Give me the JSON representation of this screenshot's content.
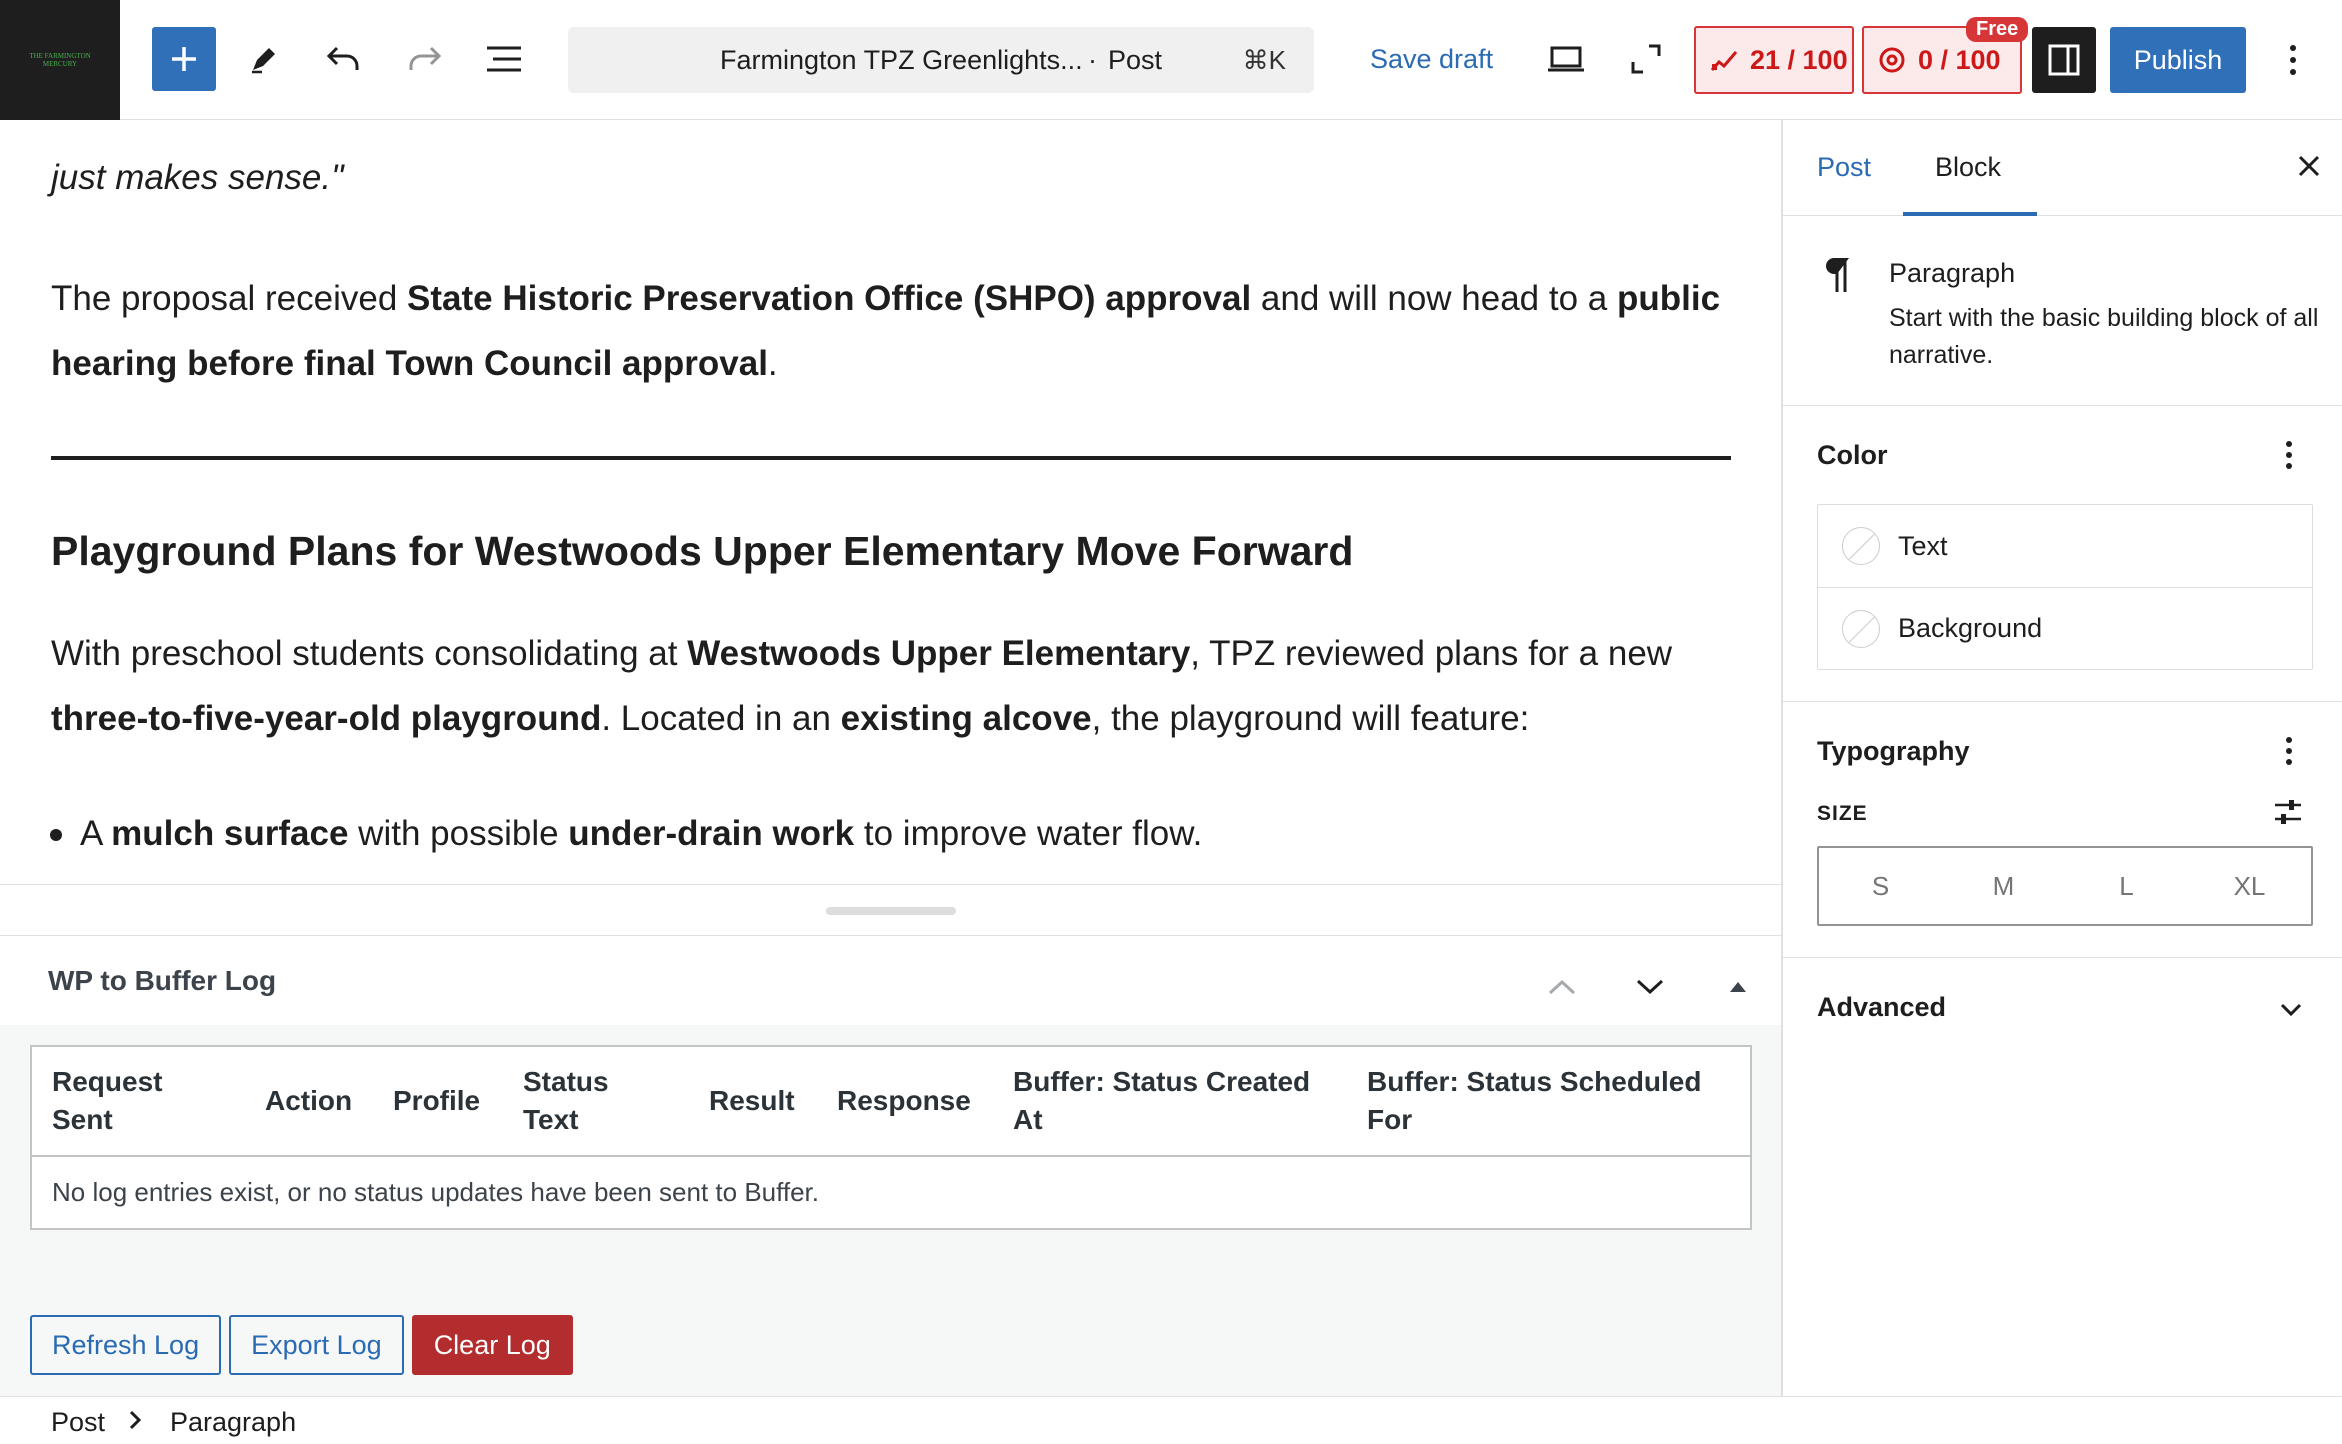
{
  "topbar": {
    "logo_text": "THE FARMINGTON MERCURY",
    "document_title": "Farmington TPZ Greenlights...",
    "document_separator": "·",
    "document_type": "Post",
    "shortcut": "⌘K",
    "save_draft_label": "Save draft",
    "seo_score": "21 / 100",
    "readability_score": "0 / 100",
    "free_tag": "Free",
    "publish_label": "Publish",
    "colors": {
      "accent": "#3070b8",
      "danger": "#d63638",
      "dark": "#1e1e1e"
    }
  },
  "editor": {
    "para1_quote_end": "just makes sense.\"",
    "para2": {
      "t1": "The proposal received ",
      "b1": "State Historic Preservation Office (SHPO) approval",
      "t2": " and will now head to a ",
      "b2": "public hearing before final Town Council approval",
      "t3": "."
    },
    "heading": "Playground Plans for Westwoods Upper Elementary Move Forward",
    "para3": {
      "t1": "With preschool students consolidating at ",
      "b1": "Westwoods Upper Elementary",
      "t2": ", TPZ reviewed plans for a new ",
      "b2": "three-to-five-year-old playground",
      "t3": ". Located in an ",
      "b3": "existing alcove",
      "t4": ", the playground will feature:"
    },
    "list_item1": {
      "t1": "A ",
      "b1": "mulch surface",
      "t2": " with possible ",
      "b2": "under-drain work",
      "t3": " to improve water flow."
    }
  },
  "meta_box": {
    "title": "WP to Buffer Log",
    "columns": [
      "Request Sent",
      "Action",
      "Profile",
      "Status Text",
      "Result",
      "Response",
      "Buffer: Status Created At",
      "Buffer: Status Scheduled For"
    ],
    "empty_message": "No log entries exist, or no status updates have been sent to Buffer.",
    "buttons": {
      "refresh": "Refresh Log",
      "export": "Export Log",
      "clear": "Clear Log"
    }
  },
  "footer": {
    "breadcrumbs": [
      "Post",
      "Paragraph"
    ]
  },
  "sidebar": {
    "tabs": [
      "Post",
      "Block"
    ],
    "active_tab": "Block",
    "block": {
      "name": "Paragraph",
      "description": "Start with the basic building block of all narrative."
    },
    "color_panel": {
      "title": "Color",
      "items": [
        "Text",
        "Background"
      ]
    },
    "typography_panel": {
      "title": "Typography",
      "size_label": "SIZE",
      "sizes": [
        "S",
        "M",
        "L",
        "XL"
      ]
    },
    "advanced_panel": {
      "title": "Advanced"
    }
  }
}
